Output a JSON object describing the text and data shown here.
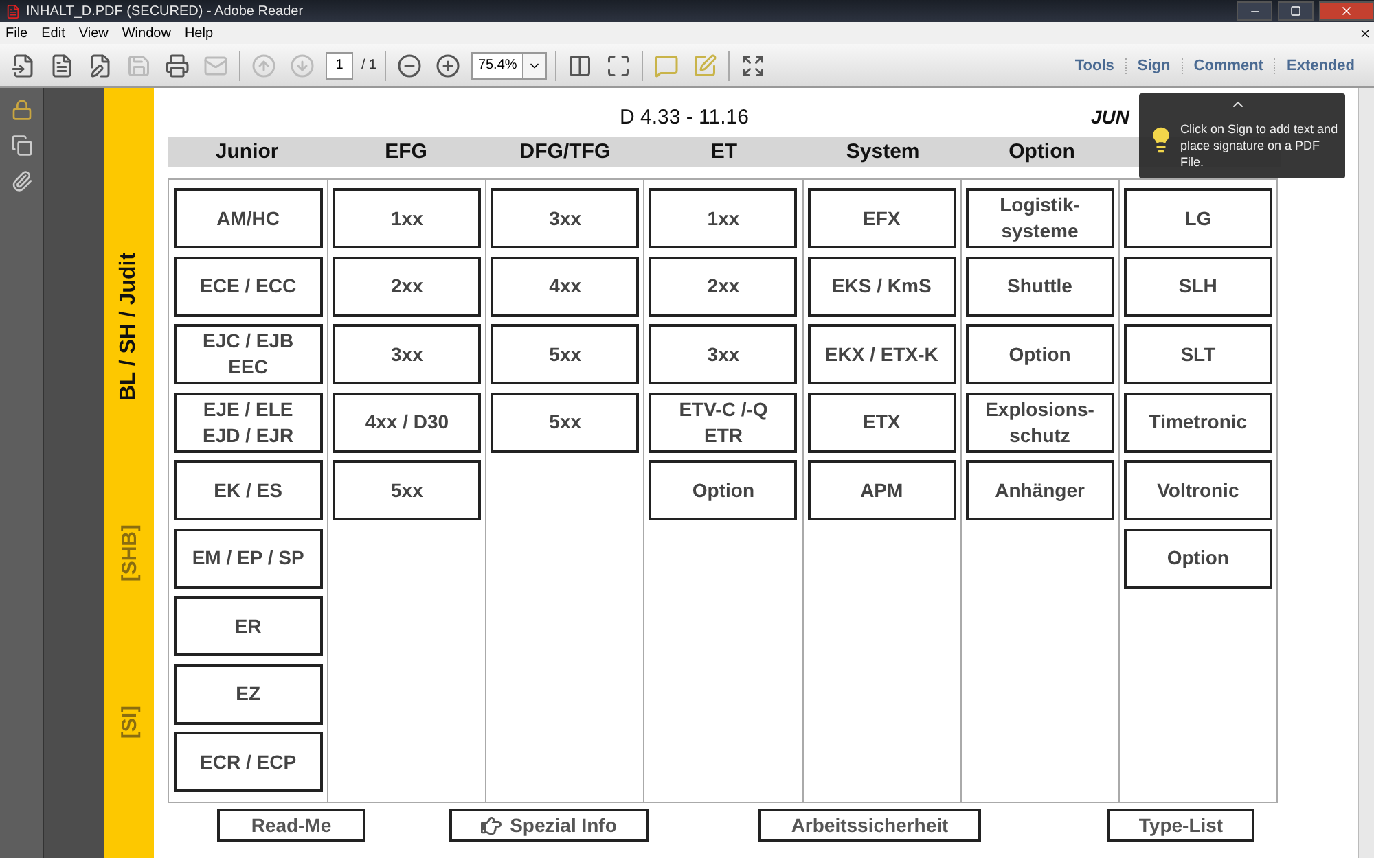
{
  "window": {
    "title": "INHALT_D.PDF (SECURED) - Adobe Reader"
  },
  "menu": [
    "File",
    "Edit",
    "View",
    "Window",
    "Help"
  ],
  "toolbar": {
    "left_buttons": [
      {
        "disabled": false
      },
      {
        "disabled": false
      },
      {
        "disabled": false
      },
      {
        "disabled": true
      },
      {
        "disabled": false
      },
      {
        "disabled": true
      }
    ],
    "nav_buttons": [
      {
        "disabled": true
      },
      {
        "disabled": true
      }
    ],
    "page": "1",
    "page_total": "/ 1",
    "zoom": "75.4%",
    "links": [
      "Tools",
      "Sign",
      "Comment",
      "Extended"
    ]
  },
  "tooltip": {
    "text": "Click on Sign to add text and place signature on a PDF File."
  },
  "document": {
    "title": "D 4.33  -  11.16",
    "logo": "JUN",
    "side_labels": [
      {
        "text": "BL / SH / Judit",
        "kind": "main"
      },
      {
        "text": "[SHB]",
        "kind": "bracket"
      },
      {
        "text": "[SI]",
        "kind": "bracket"
      }
    ],
    "columns": [
      {
        "header": "Junior",
        "cells": [
          "AM/HC",
          "ECE / ECC",
          "EJC / EJB\nEEC",
          "EJE / ELE\nEJD / EJR",
          "EK / ES",
          "EM / EP / SP",
          "ER",
          "EZ",
          "ECR / ECP"
        ]
      },
      {
        "header": "EFG",
        "cells": [
          "1xx",
          "2xx",
          "3xx",
          "4xx / D30",
          "5xx"
        ]
      },
      {
        "header": "DFG/TFG",
        "cells": [
          "3xx",
          "4xx",
          "5xx",
          "5xx"
        ]
      },
      {
        "header": "ET",
        "cells": [
          "1xx",
          "2xx",
          "3xx",
          "ETV-C /-Q\nETR",
          "Option"
        ]
      },
      {
        "header": "System",
        "cells": [
          "EFX",
          "EKS / KmS",
          "EKX / ETX-K",
          "ETX",
          "APM"
        ]
      },
      {
        "header": "Option",
        "cells": [
          "Logistik-\nsysteme",
          "Shuttle",
          "Option",
          "Explosions-\nschutz",
          "Anhänger"
        ]
      },
      {
        "cells": [
          "LG",
          "SLH",
          "SLT",
          "Timetronic",
          "Voltronic",
          "Option"
        ]
      }
    ],
    "footer_buttons": [
      {
        "label": "Read-Me",
        "kind": "plain"
      },
      {
        "label": "Spezial Info",
        "kind": "pointer"
      },
      {
        "label": "Arbeitssicherheit",
        "kind": "plain"
      },
      {
        "label": "Type-List",
        "kind": "plain"
      }
    ]
  }
}
